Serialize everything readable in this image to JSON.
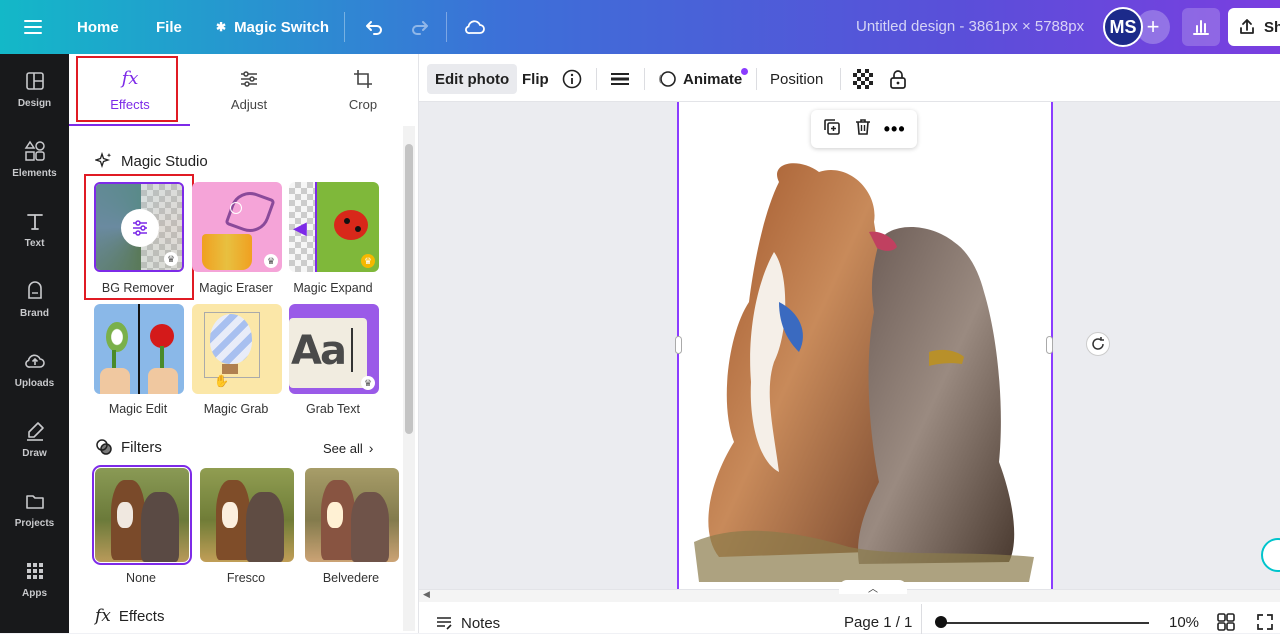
{
  "topbar": {
    "home": "Home",
    "file": "File",
    "magic_switch": "Magic Switch",
    "title": "Untitled design - 3861px × 5788px",
    "avatar": "MS",
    "share": "Sh"
  },
  "rail": {
    "items": [
      {
        "label": "Design",
        "icon": "design-icon"
      },
      {
        "label": "Elements",
        "icon": "elements-icon"
      },
      {
        "label": "Text",
        "icon": "text-icon"
      },
      {
        "label": "Brand",
        "icon": "brand-icon"
      },
      {
        "label": "Uploads",
        "icon": "uploads-icon"
      },
      {
        "label": "Draw",
        "icon": "draw-icon"
      },
      {
        "label": "Projects",
        "icon": "folder-icon"
      },
      {
        "label": "Apps",
        "icon": "apps-icon"
      }
    ]
  },
  "panel": {
    "tabs": [
      {
        "label": "Effects",
        "icon_text": "fx"
      },
      {
        "label": "Adjust"
      },
      {
        "label": "Crop"
      }
    ],
    "magic_studio": {
      "title": "Magic Studio",
      "tools": [
        {
          "label": "BG Remover"
        },
        {
          "label": "Magic Eraser"
        },
        {
          "label": "Magic Expand"
        },
        {
          "label": "Magic Edit"
        },
        {
          "label": "Magic Grab"
        },
        {
          "label": "Grab Text",
          "thumb_text": "Aa"
        }
      ]
    },
    "filters": {
      "title": "Filters",
      "see_all": "See all",
      "items": [
        {
          "label": "None"
        },
        {
          "label": "Fresco"
        },
        {
          "label": "Belvedere"
        }
      ]
    },
    "effects": {
      "title": "Effects",
      "icon_text": "fx"
    }
  },
  "context_toolbar": {
    "edit_photo": "Edit photo",
    "flip": "Flip",
    "animate": "Animate",
    "position": "Position"
  },
  "bottombar": {
    "notes": "Notes",
    "page": "Page 1 / 1",
    "zoom": "10%",
    "zoom_level": 0.1
  },
  "colors": {
    "accent": "#7d2ae8",
    "highlight_box": "#e01b24",
    "rail_bg": "#18191b"
  }
}
